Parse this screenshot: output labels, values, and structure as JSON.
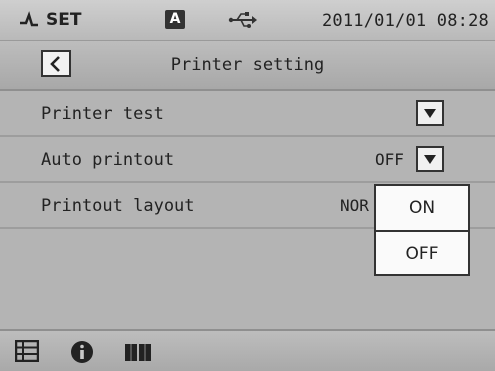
{
  "status_bar": {
    "mode_label": "SET",
    "badge": "A",
    "datetime": "2011/01/01 08:28",
    "icons": [
      "probe-icon",
      "usb-icon"
    ]
  },
  "header": {
    "title": "Printer setting",
    "back_icon": "chevron-left-icon"
  },
  "settings": [
    {
      "label": "Printer test",
      "value": ""
    },
    {
      "label": "Auto printout",
      "value": "OFF"
    },
    {
      "label": "Printout layout",
      "value": "NOR"
    }
  ],
  "dropdown": {
    "options": [
      "ON",
      "OFF"
    ]
  },
  "bottom_bar": {
    "icons": [
      "list-icon",
      "info-icon",
      "book-icon"
    ]
  }
}
